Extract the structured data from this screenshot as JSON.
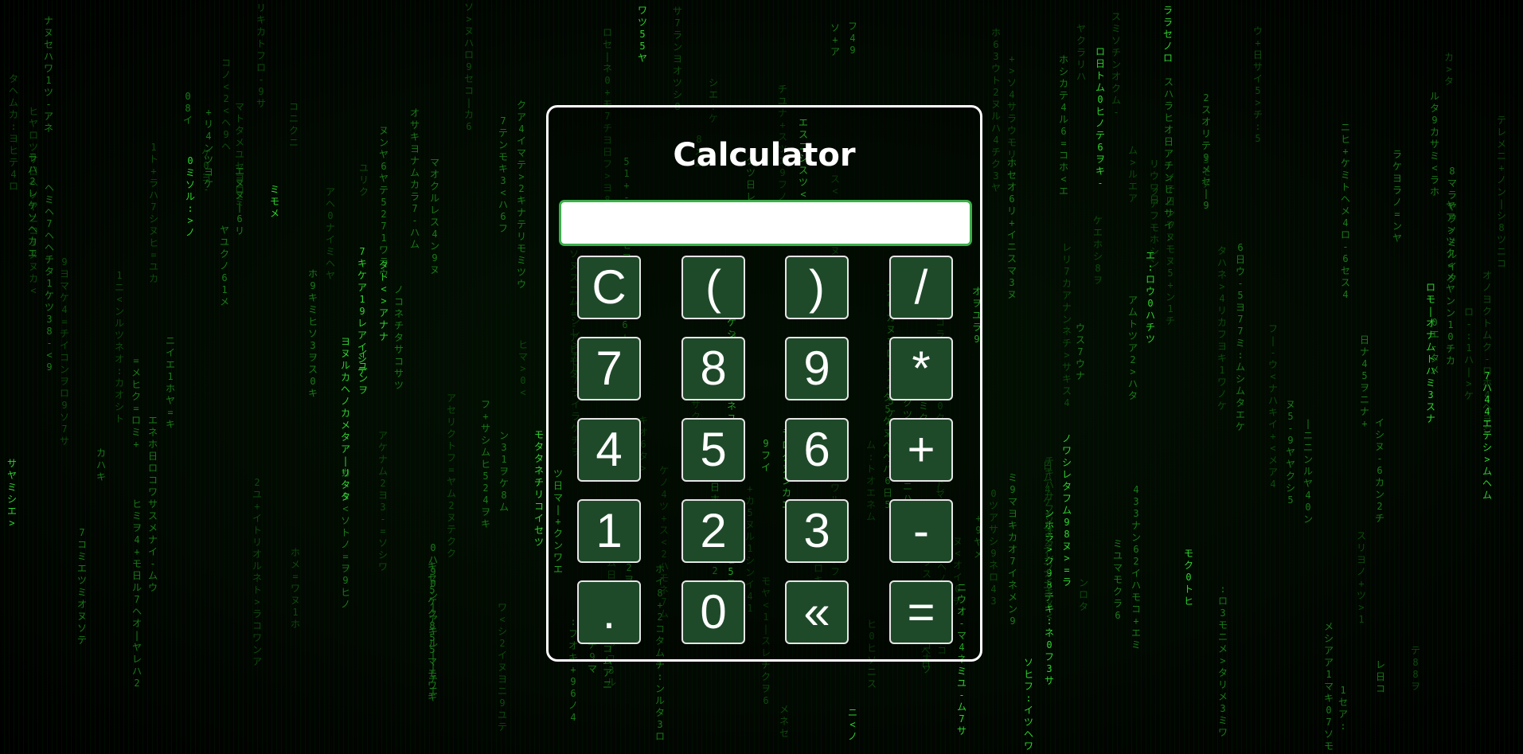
{
  "calculator": {
    "title": "Calculator",
    "display_value": "",
    "keys": [
      {
        "id": "clear",
        "label": "C"
      },
      {
        "id": "open-paren",
        "label": "("
      },
      {
        "id": "close-paren",
        "label": ")"
      },
      {
        "id": "divide",
        "label": "/"
      },
      {
        "id": "seven",
        "label": "7"
      },
      {
        "id": "eight",
        "label": "8"
      },
      {
        "id": "nine",
        "label": "9"
      },
      {
        "id": "multiply",
        "label": "*"
      },
      {
        "id": "four",
        "label": "4"
      },
      {
        "id": "five",
        "label": "5"
      },
      {
        "id": "six",
        "label": "6"
      },
      {
        "id": "add",
        "label": "+"
      },
      {
        "id": "one",
        "label": "1"
      },
      {
        "id": "two",
        "label": "2"
      },
      {
        "id": "three",
        "label": "3"
      },
      {
        "id": "subtract",
        "label": "-"
      },
      {
        "id": "decimal",
        "label": "."
      },
      {
        "id": "zero",
        "label": "0"
      },
      {
        "id": "backspace",
        "label": "«"
      },
      {
        "id": "equals",
        "label": "="
      }
    ]
  },
  "theme": {
    "background": "#000000",
    "rain_color": "#2fd42f",
    "key_fill": "#1f4a2a",
    "key_border": "#e6e6e6",
    "display_border": "#3cb04a",
    "frame_border": "#ffffff"
  }
}
